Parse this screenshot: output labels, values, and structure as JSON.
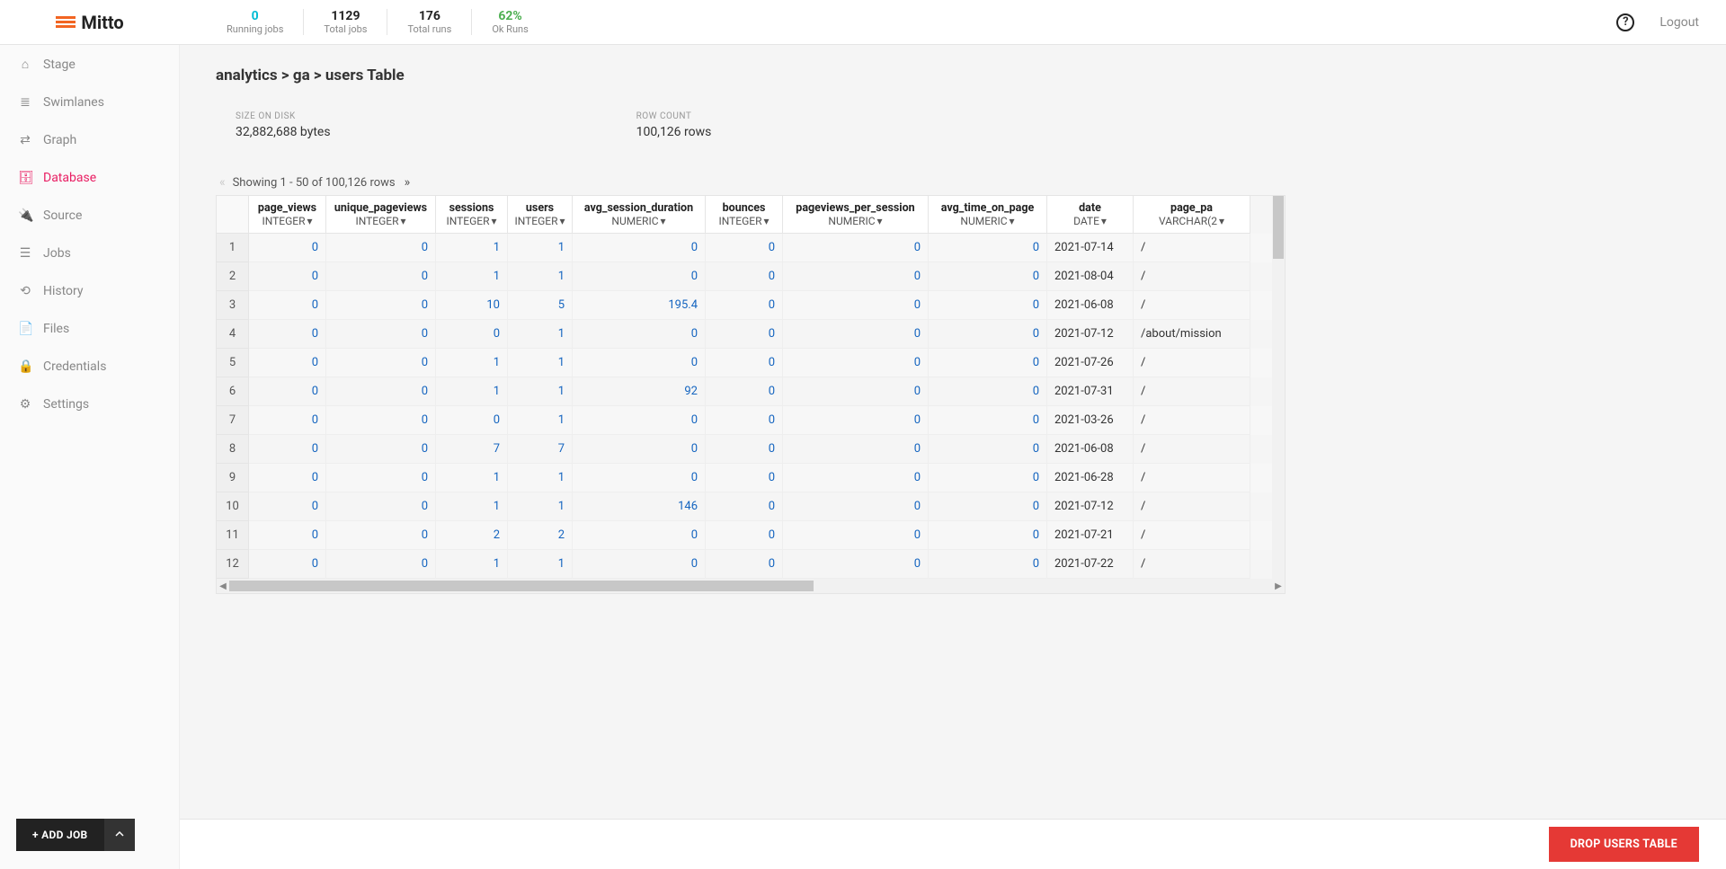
{
  "logo_text": "Mitto",
  "header": {
    "stats": [
      {
        "value": "0",
        "label": "Running jobs",
        "class": "cyan"
      },
      {
        "value": "1129",
        "label": "Total jobs",
        "class": ""
      },
      {
        "value": "176",
        "label": "Total runs",
        "class": ""
      },
      {
        "value": "62%",
        "label": "Ok Runs",
        "class": "green"
      }
    ],
    "logout": "Logout"
  },
  "sidebar": [
    {
      "icon": "home-icon",
      "glyph": "⌂",
      "label": "Stage"
    },
    {
      "icon": "swimlanes-icon",
      "glyph": "≣",
      "label": "Swimlanes"
    },
    {
      "icon": "graph-icon",
      "glyph": "⇄",
      "label": "Graph"
    },
    {
      "icon": "database-icon",
      "glyph": "🗄",
      "label": "Database"
    },
    {
      "icon": "source-icon",
      "glyph": "🔌",
      "label": "Source"
    },
    {
      "icon": "jobs-icon",
      "glyph": "☰",
      "label": "Jobs"
    },
    {
      "icon": "history-icon",
      "glyph": "⟲",
      "label": "History"
    },
    {
      "icon": "files-icon",
      "glyph": "📄",
      "label": "Files"
    },
    {
      "icon": "credentials-icon",
      "glyph": "🔒",
      "label": "Credentials"
    },
    {
      "icon": "settings-icon",
      "glyph": "⚙",
      "label": "Settings"
    }
  ],
  "sidebar_active_index": 3,
  "add_job": "+ ADD JOB",
  "breadcrumb": {
    "parts": [
      "analytics",
      "ga",
      "users Table"
    ]
  },
  "info": {
    "size_label": "SIZE ON DISK",
    "size_value": "32,882,688 bytes",
    "rows_label": "ROW COUNT",
    "rows_value": "100,126 rows"
  },
  "pager": "Showing 1 - 50 of 100,126 rows",
  "columns": [
    {
      "name": "page_views",
      "type": "INTEGER",
      "cls": "c-pv",
      "align": "num"
    },
    {
      "name": "unique_pageviews",
      "type": "INTEGER",
      "cls": "c-upv",
      "align": "num"
    },
    {
      "name": "sessions",
      "type": "INTEGER",
      "cls": "c-sess",
      "align": "num"
    },
    {
      "name": "users",
      "type": "INTEGER",
      "cls": "c-users",
      "align": "num"
    },
    {
      "name": "avg_session_duration",
      "type": "NUMERIC",
      "cls": "c-asd",
      "align": "num"
    },
    {
      "name": "bounces",
      "type": "INTEGER",
      "cls": "c-bounces",
      "align": "num"
    },
    {
      "name": "pageviews_per_session",
      "type": "NUMERIC",
      "cls": "c-pps",
      "align": "num"
    },
    {
      "name": "avg_time_on_page",
      "type": "NUMERIC",
      "cls": "c-atop",
      "align": "num"
    },
    {
      "name": "date",
      "type": "DATE",
      "cls": "c-date",
      "align": "text"
    },
    {
      "name": "page_pa",
      "type": "VARCHAR(2",
      "cls": "c-path",
      "align": "text"
    }
  ],
  "rows": [
    [
      "0",
      "0",
      "1",
      "1",
      "0",
      "0",
      "0",
      "0",
      "2021-07-14",
      "/"
    ],
    [
      "0",
      "0",
      "1",
      "1",
      "0",
      "0",
      "0",
      "0",
      "2021-08-04",
      "/"
    ],
    [
      "0",
      "0",
      "10",
      "5",
      "195.4",
      "0",
      "0",
      "0",
      "2021-06-08",
      "/"
    ],
    [
      "0",
      "0",
      "0",
      "1",
      "0",
      "0",
      "0",
      "0",
      "2021-07-12",
      "/about/mission"
    ],
    [
      "0",
      "0",
      "1",
      "1",
      "0",
      "0",
      "0",
      "0",
      "2021-07-26",
      "/"
    ],
    [
      "0",
      "0",
      "1",
      "1",
      "92",
      "0",
      "0",
      "0",
      "2021-07-31",
      "/"
    ],
    [
      "0",
      "0",
      "0",
      "1",
      "0",
      "0",
      "0",
      "0",
      "2021-03-26",
      "/"
    ],
    [
      "0",
      "0",
      "7",
      "7",
      "0",
      "0",
      "0",
      "0",
      "2021-06-08",
      "/"
    ],
    [
      "0",
      "0",
      "1",
      "1",
      "0",
      "0",
      "0",
      "0",
      "2021-06-28",
      "/"
    ],
    [
      "0",
      "0",
      "1",
      "1",
      "146",
      "0",
      "0",
      "0",
      "2021-07-12",
      "/"
    ],
    [
      "0",
      "0",
      "2",
      "2",
      "0",
      "0",
      "0",
      "0",
      "2021-07-21",
      "/"
    ],
    [
      "0",
      "0",
      "1",
      "1",
      "0",
      "0",
      "0",
      "0",
      "2021-07-22",
      "/"
    ]
  ],
  "footer": {
    "drop": "DROP USERS TABLE"
  }
}
